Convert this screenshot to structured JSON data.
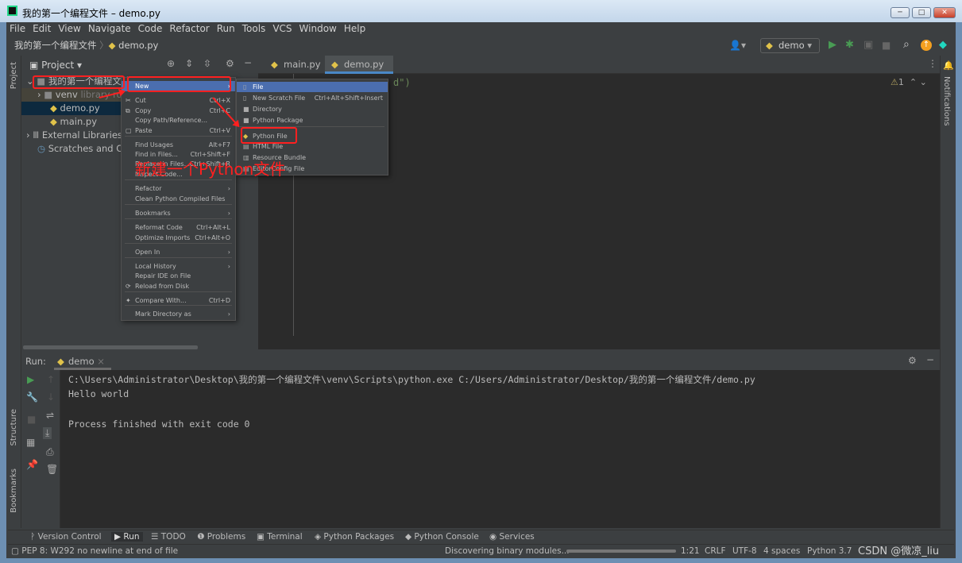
{
  "window": {
    "title": "我的第一个编程文件 – demo.py",
    "min": "─",
    "max": "□",
    "close": "✕"
  },
  "menu": [
    "File",
    "Edit",
    "View",
    "Navigate",
    "Code",
    "Refactor",
    "Run",
    "Tools",
    "VCS",
    "Window",
    "Help"
  ],
  "breadcrumb": {
    "project": "我的第一个编程文件",
    "file": "demo.py"
  },
  "toolbar": {
    "run_config": "demo"
  },
  "project_panel": {
    "title": "Project",
    "tree": [
      {
        "label": "我的第一个编程文件",
        "type": "folder"
      },
      {
        "label": "venv",
        "hint": "library root",
        "type": "folder"
      },
      {
        "label": "demo.py",
        "type": "py",
        "selected": true
      },
      {
        "label": "main.py",
        "type": "py"
      },
      {
        "label": "External Libraries",
        "type": "lib"
      },
      {
        "label": "Scratches and Consoles",
        "type": "scratch"
      }
    ]
  },
  "editor": {
    "tabs": [
      "main.py",
      "demo.py"
    ],
    "active_tab": "demo.py",
    "code_fragment": "d\")",
    "warnings": "1"
  },
  "left_stripe": {
    "project": "Project",
    "structure": "Structure",
    "bookmarks": "Bookmarks"
  },
  "right_stripe": {
    "notifications": "Notifications"
  },
  "context_menu": [
    {
      "label": "New",
      "shortcut": "",
      "submenu": true,
      "selected": true
    },
    {
      "label": "Cut",
      "shortcut": "Ctrl+X"
    },
    {
      "label": "Copy",
      "shortcut": "Ctrl+C"
    },
    {
      "label": "Copy Path/Reference...",
      "shortcut": ""
    },
    {
      "label": "Paste",
      "shortcut": "Ctrl+V"
    },
    {
      "label": "Find Usages",
      "shortcut": "Alt+F7"
    },
    {
      "label": "Find in Files...",
      "shortcut": "Ctrl+Shift+F"
    },
    {
      "label": "Replace in Files...",
      "shortcut": "Ctrl+Shift+R"
    },
    {
      "label": "Inspect Code...",
      "shortcut": ""
    },
    {
      "label": "Refactor",
      "shortcut": "",
      "submenu": true
    },
    {
      "label": "Clean Python Compiled Files",
      "shortcut": ""
    },
    {
      "label": "Bookmarks",
      "shortcut": "",
      "submenu": true
    },
    {
      "label": "Reformat Code",
      "shortcut": "Ctrl+Alt+L"
    },
    {
      "label": "Optimize Imports",
      "shortcut": "Ctrl+Alt+O"
    },
    {
      "label": "Open In",
      "shortcut": "",
      "submenu": true
    },
    {
      "label": "Local History",
      "shortcut": "",
      "submenu": true
    },
    {
      "label": "Repair IDE on File",
      "shortcut": ""
    },
    {
      "label": "Reload from Disk",
      "shortcut": ""
    },
    {
      "label": "Compare With...",
      "shortcut": "Ctrl+D"
    },
    {
      "label": "Mark Directory as",
      "shortcut": "",
      "submenu": true
    }
  ],
  "new_submenu": [
    {
      "label": "File",
      "shortcut": "",
      "selected": true
    },
    {
      "label": "New Scratch File",
      "shortcut": "Ctrl+Alt+Shift+Insert"
    },
    {
      "label": "Directory",
      "shortcut": ""
    },
    {
      "label": "Python Package",
      "shortcut": ""
    },
    {
      "label": "Python File",
      "shortcut": ""
    },
    {
      "label": "HTML File",
      "shortcut": ""
    },
    {
      "label": "Resource Bundle",
      "shortcut": ""
    },
    {
      "label": "EditorConfig File",
      "shortcut": ""
    }
  ],
  "annotation": "新建一个Python文件",
  "run_panel": {
    "label": "Run:",
    "tab": "demo",
    "lines": [
      "C:\\Users\\Administrator\\Desktop\\我的第一个编程文件\\venv\\Scripts\\python.exe C:/Users/Administrator/Desktop/我的第一个编程文件/demo.py",
      "Hello world",
      "",
      "Process finished with exit code 0"
    ]
  },
  "bottom_tabs": [
    "Version Control",
    "Run",
    "TODO",
    "Problems",
    "Terminal",
    "Python Packages",
    "Python Console",
    "Services"
  ],
  "status": {
    "message": "PEP 8: W292 no newline at end of file",
    "progress_text": "Discovering binary modules...",
    "position": "1:21",
    "line_sep": "CRLF",
    "encoding": "UTF-8",
    "indent": "4 spaces",
    "interpreter": "Python 3.7",
    "watermark": "CSDN @微凉_liu"
  },
  "colors": {
    "accent": "#4b6eaf",
    "annotation": "#ff2020",
    "run_green": "#499c54"
  }
}
